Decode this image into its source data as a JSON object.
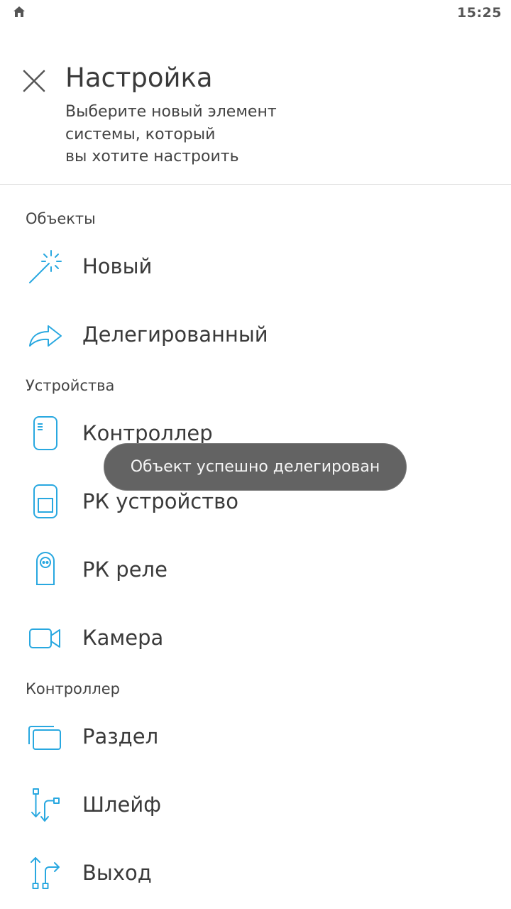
{
  "status_bar": {
    "time": "15:25",
    "home_icon": "home-icon"
  },
  "header": {
    "title": "Настройка",
    "subtitle": "Выберите новый элемент\nсистемы, который\nвы хотите настроить",
    "close_icon": "close-icon"
  },
  "sections": {
    "objects": {
      "title": "Объекты",
      "items": [
        {
          "label": "Новый",
          "icon": "magic-wand-icon"
        },
        {
          "label": "Делегированный",
          "icon": "share-arrow-icon"
        }
      ]
    },
    "devices": {
      "title": "Устройства",
      "items": [
        {
          "label": "Контроллер",
          "icon": "controller-icon"
        },
        {
          "label": "РК устройство",
          "icon": "rk-device-icon"
        },
        {
          "label": "РК реле",
          "icon": "rk-relay-icon"
        },
        {
          "label": "Камера",
          "icon": "camera-icon"
        }
      ]
    },
    "controller": {
      "title": "Контроллер",
      "items": [
        {
          "label": "Раздел",
          "icon": "partition-icon"
        },
        {
          "label": "Шлейф",
          "icon": "loop-icon"
        },
        {
          "label": "Выход",
          "icon": "output-icon"
        }
      ]
    }
  },
  "toast": {
    "text": "Объект успешно делегирован"
  },
  "colors": {
    "accent": "#29a8e0",
    "toast_bg": "#636363",
    "divider": "#dcdcdc"
  }
}
